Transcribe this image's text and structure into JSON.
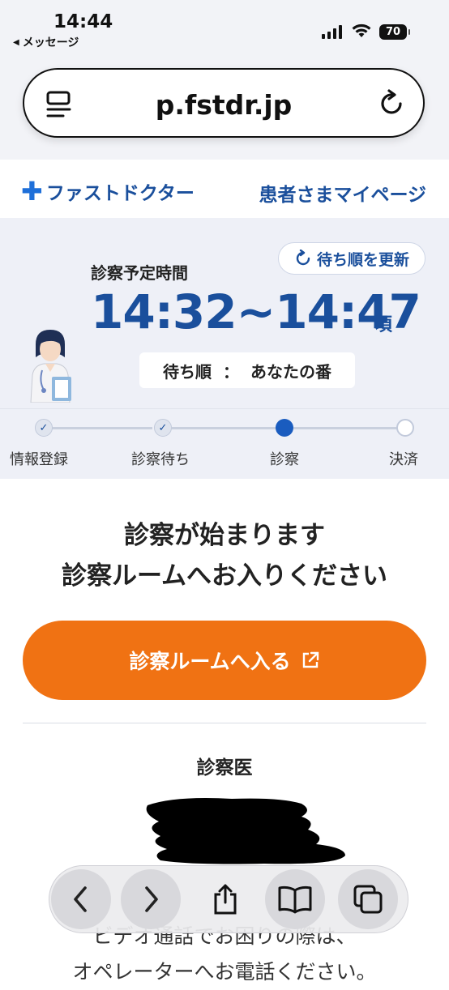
{
  "status_bar": {
    "time": "14:44",
    "back_label": "メッセージ",
    "battery": "70"
  },
  "browser": {
    "url": "p.fstdr.jp"
  },
  "site": {
    "logo_text": "ファストドクター",
    "mypage_link": "患者さまマイページ"
  },
  "wait": {
    "refresh_label": "待ち順を更新",
    "schedule_label": "診察予定時間",
    "schedule_time": "14:32~14:47",
    "schedule_suffix": "頃",
    "order_label": "待ち順",
    "order_separator": "：",
    "order_value": "あなたの番"
  },
  "steps": [
    {
      "label": "情報登録",
      "state": "done"
    },
    {
      "label": "診察待ち",
      "state": "done"
    },
    {
      "label": "診察",
      "state": "current"
    },
    {
      "label": "決済",
      "state": "todo"
    }
  ],
  "main": {
    "message_line1": "診察が始まります",
    "message_line2": "診察ルームへお入りください",
    "enter_button": "診察ルームへ入る",
    "doctor_label": "診察医"
  },
  "bottom_note": {
    "line1": "ビデオ通話でお困りの際は、",
    "line2": "オペレーターへお電話ください。"
  },
  "colors": {
    "brand_blue": "#1a4f9c",
    "accent_orange": "#f07213",
    "panel_bg": "#eef0f7"
  },
  "icons": {
    "reader": "reader-icon",
    "reload": "reload-icon",
    "refresh": "refresh-icon",
    "external": "external-link-icon",
    "back": "chevron-left-icon",
    "forward": "chevron-right-icon",
    "share": "share-icon",
    "bookmarks": "book-icon",
    "tabs": "tabs-icon"
  }
}
